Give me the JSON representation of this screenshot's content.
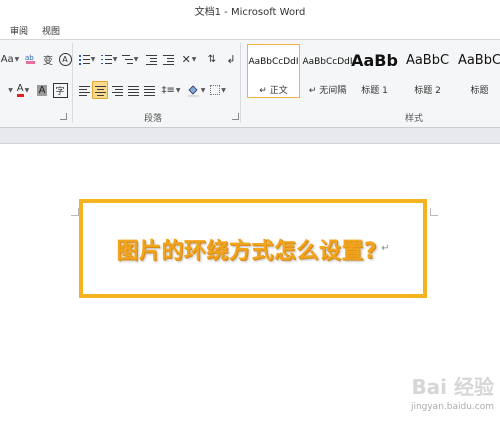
{
  "window": {
    "title": "文档1 - Microsoft Word"
  },
  "menu": {
    "tabs": [
      "审阅",
      "视图"
    ]
  },
  "ribbon": {
    "font_group": {
      "size_label": "Aa",
      "font_color_letter": "A",
      "char_border_letter": "A",
      "circle_letter": "字",
      "phonetic_letter": "变"
    },
    "paragraph_group": {
      "label": "段落"
    },
    "styles_group": {
      "label": "样式",
      "items": [
        {
          "preview": "AaBbCcDdI",
          "name": "↵ 正文",
          "active": true
        },
        {
          "preview": "AaBbCcDdI",
          "name": "↵ 无间隔",
          "active": false
        },
        {
          "preview": "AaBb",
          "name": "标题 1",
          "active": false
        },
        {
          "preview": "AaBbC",
          "name": "标题 2",
          "active": false
        },
        {
          "preview": "AaBbC",
          "name": "标题",
          "active": false
        }
      ]
    }
  },
  "document": {
    "heading": "图片的环绕方式怎么设置?",
    "paragraph_mark": "↵"
  },
  "watermark": {
    "brand": "Bai 经验",
    "site": "jingyan.baidu.com"
  },
  "colors": {
    "accent": "#f5b31f",
    "heading_text": "#f1a41e",
    "selected_button": "#fcd98c"
  }
}
